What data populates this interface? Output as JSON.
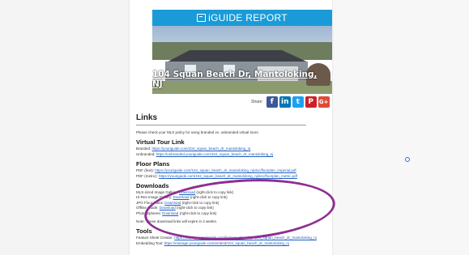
{
  "header": {
    "title": "iGUIDE REPORT"
  },
  "hero": {
    "address": "104 Squan Beach Dr, Mantoloking, NJ"
  },
  "share": {
    "label": "Share:",
    "icons": [
      "facebook-icon",
      "linkedin-icon",
      "twitter-icon",
      "pinterest-icon",
      "googleplus-icon"
    ]
  },
  "links": {
    "title": "Links",
    "note": "Please check your MLS policy for using branded vs. unbranded virtual tours.",
    "virtual_tour": {
      "title": "Virtual Tour Link",
      "branded_label": "Branded:",
      "branded_url": "https://youriguide.com/104_squan_beach_dr_mantoloking_nj",
      "unbranded_label": "Unbranded:",
      "unbranded_url": "https://unbranded.youriguide.com/104_squan_beach_dr_mantoloking_nj"
    },
    "floor_plans": {
      "title": "Floor Plans",
      "pdf_feet_label": "PDF (feet):",
      "pdf_feet_url": "https://youriguide.com/104_squan_beach_dr_mantoloking_nj/doc/floorplan_imperial.pdf",
      "pdf_metric_label": "PDF (metric):",
      "pdf_metric_url": "https://youriguide.com/104_squan_beach_dr_mantoloking_nj/doc/floorplan_metric.pdf"
    },
    "downloads": {
      "title": "Downloads",
      "items": [
        {
          "label": "MLS-sized Image Gallery:",
          "link": "Download",
          "hint": "(right-click to copy link)"
        },
        {
          "label": "Hi-Res Image Gallery:",
          "link": "Download",
          "hint": "(right-click to copy link)"
        },
        {
          "label": "JPG Floor Plans:",
          "link": "Download",
          "hint": "(right-click to copy link)"
        },
        {
          "label": "Offline Guide:",
          "link": "Download",
          "hint": "(right-click to copy link)"
        },
        {
          "label": "Photo Spheres:",
          "link": "Download",
          "hint": "(right-click to copy link)"
        }
      ],
      "note": "Note: These download links will expire in 2 weeks."
    },
    "tools": {
      "title": "Tools",
      "feature_label": "Feature Sheet Creator:",
      "feature_url": "https://manage.youriguide.com/feature_sheet/?p=104_squan_beach_dr_mantoloking_nj",
      "embed_label": "Embedding Tool:",
      "embed_url": "https://manage.youriguide.com/embed/104_squan_beach_dr_mantoloking_nj"
    }
  },
  "colors": {
    "accent": "#1a9bd7",
    "highlight": "#8e2e93"
  }
}
